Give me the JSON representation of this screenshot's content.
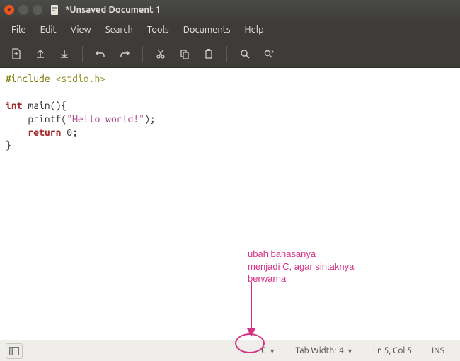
{
  "window": {
    "title": "*Unsaved Document 1"
  },
  "menu": {
    "file": "File",
    "edit": "Edit",
    "view": "View",
    "search": "Search",
    "tools": "Tools",
    "documents": "Documents",
    "help": "Help"
  },
  "code": {
    "line1_directive": "#include",
    "line1_header": "<stdio.h>",
    "line3_kw_int": "int",
    "line3_rest": " main(){",
    "line4_indent": "    printf(",
    "line4_string": "\"Hello world!\"",
    "line4_end": ");",
    "line5_indent": "    ",
    "line5_kw_return": "return",
    "line5_val": " 0;",
    "line6": "}"
  },
  "annotation": {
    "text": "ubah bahasanya\nmenjadi C, agar sintaknya\nberwarna"
  },
  "status": {
    "language": "C",
    "tabwidth_label": "Tab Width:",
    "tabwidth_value": "4",
    "position": "Ln 5, Col 5",
    "mode": "INS"
  }
}
